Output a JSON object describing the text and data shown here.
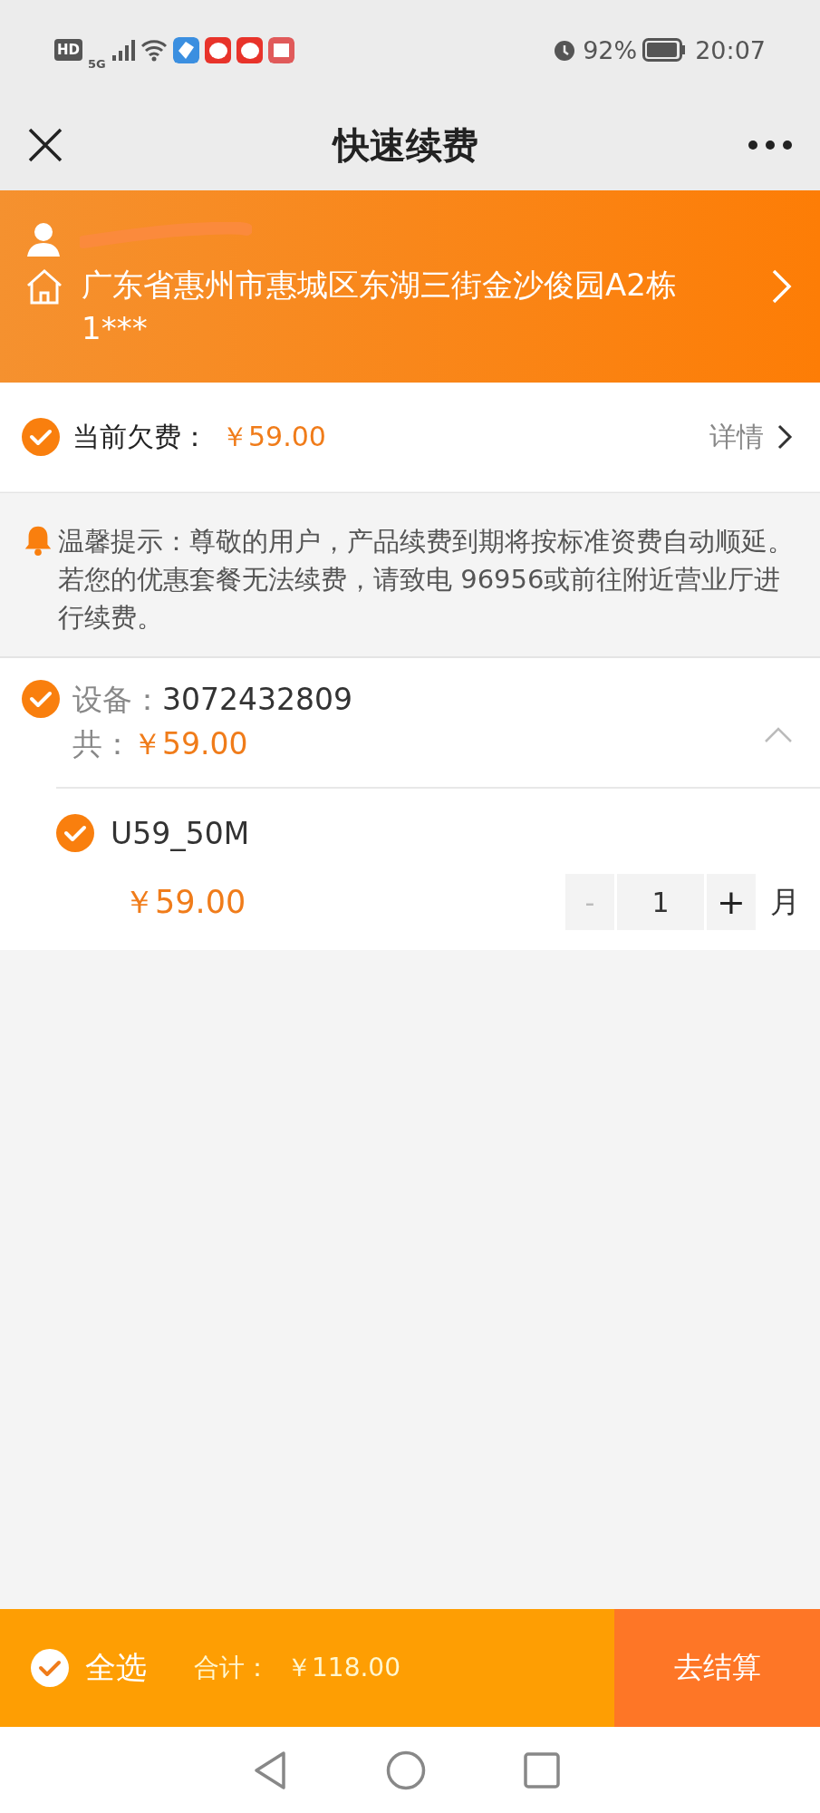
{
  "status_bar": {
    "hd": "HD",
    "network": "5G",
    "battery": "92%",
    "time": "20:07"
  },
  "nav": {
    "title": "快速续费"
  },
  "address": {
    "text": "广东省惠州市惠城区东湖三街金沙俊园A2栋1***"
  },
  "arrears": {
    "checked": true,
    "label": "当前欠费：",
    "amount": "￥59.00",
    "details": "详情"
  },
  "tip": {
    "text": "温馨提示：尊敬的用户，产品续费到期将按标准资费自动顺延。若您的优惠套餐无法续费，请致电 96956或前往附近营业厅进行续费。"
  },
  "device": {
    "checked": true,
    "expanded": true,
    "label": "设备：",
    "number": "3072432809",
    "total_label": "共：",
    "total": "￥59.00",
    "packages": [
      {
        "name": "U59_50M",
        "checked": true,
        "price": "￥59.00",
        "minus": "-",
        "minus_disabled": true,
        "quantity": "1",
        "plus": "+",
        "unit": "月"
      }
    ]
  },
  "checkout": {
    "all_checked": true,
    "select_all": "全选",
    "total_label": "合计：",
    "total": "￥118.00",
    "button": "去结算"
  }
}
